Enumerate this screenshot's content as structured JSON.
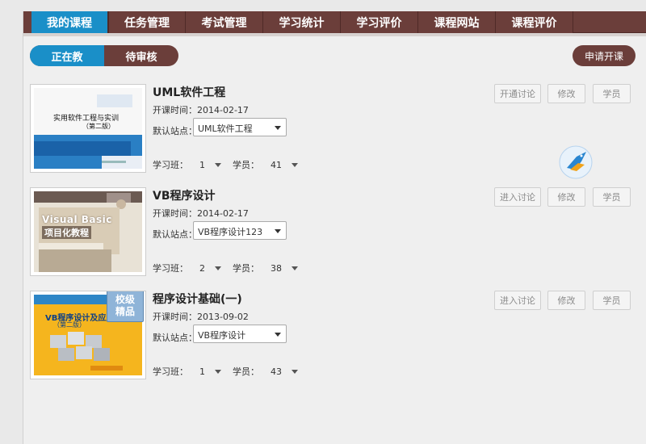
{
  "nav": {
    "tabs": [
      "我的课程",
      "任务管理",
      "考试管理",
      "学习统计",
      "学习评价",
      "课程网站",
      "课程评价"
    ]
  },
  "filter": {
    "teaching": "正在教",
    "pending": "待审核"
  },
  "apply_label": "申请开课",
  "labels": {
    "date_prefix": "开课时间：",
    "site_prefix": "默认站点：",
    "class_label": "学习班：",
    "students_label": "学员："
  },
  "courses": [
    {
      "title": "UML软件工程",
      "date": "2014-02-17",
      "site": "UML软件工程",
      "class_count": "1",
      "student_count": "41",
      "actions": [
        "开通讨论",
        "修改",
        "学员"
      ],
      "cover_text": [
        "实用软件工程与实训",
        "（第二版）"
      ]
    },
    {
      "title": "VB程序设计",
      "date": "2014-02-17",
      "site": "VB程序设计123",
      "class_count": "2",
      "student_count": "38",
      "actions": [
        "进入讨论",
        "修改",
        "学员"
      ],
      "cover_text": [
        "Visual Basic",
        "项目化教程"
      ]
    },
    {
      "title": "程序设计基础(一)",
      "date": "2013-09-02",
      "site": "VB程序设计",
      "class_count": "1",
      "student_count": "43",
      "actions": [
        "进入讨论",
        "修改",
        "学员"
      ],
      "cover_text": [
        "VB程序设计及应用",
        "（第二版）"
      ],
      "badge": [
        "校级",
        "精品"
      ]
    }
  ],
  "colors": {
    "nav_bg": "#6b3e3a",
    "accent": "#1a8fc8"
  }
}
